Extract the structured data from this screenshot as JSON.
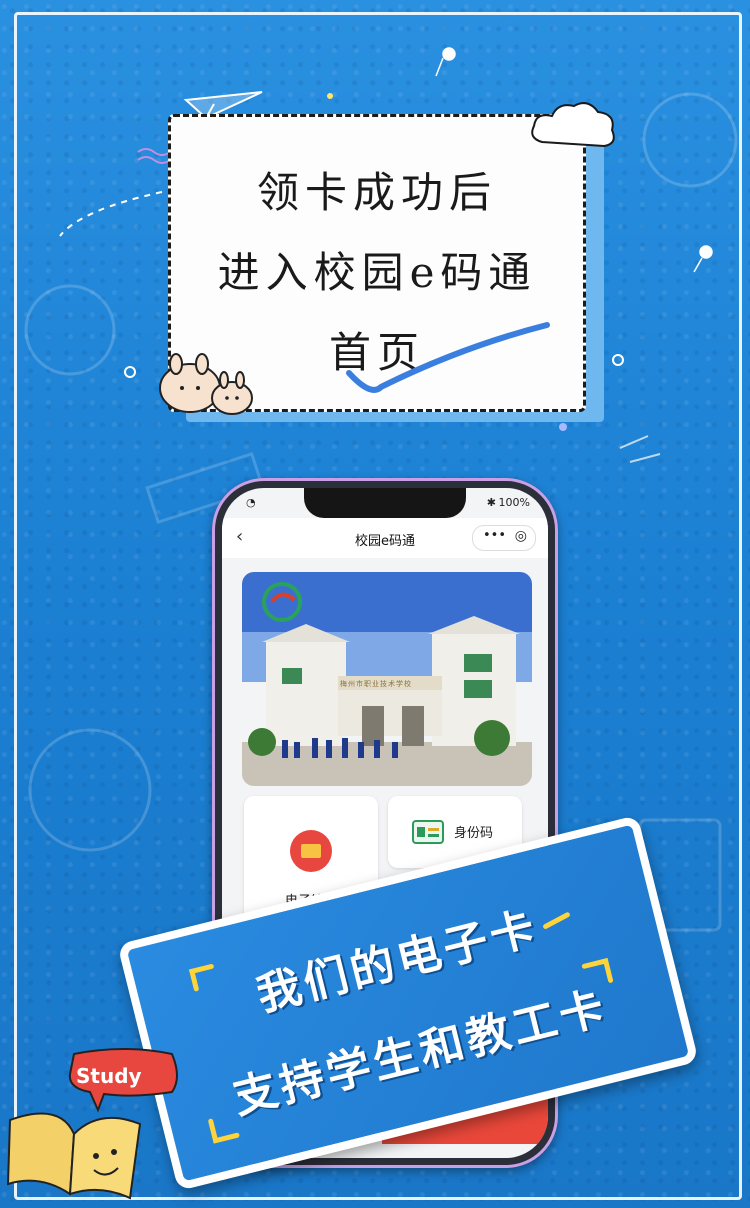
{
  "note": {
    "line1": "领卡成功后",
    "line2": "进入校园e码通",
    "line3": "首页"
  },
  "phone": {
    "status_battery": "100%",
    "nav_title": "校园e码通",
    "back_icon": "chevron-left-icon",
    "more_icon": "more-dots-icon",
    "close_icon": "target-close-icon",
    "banner_school_sign": "梅州市职业技术学校",
    "tiles": [
      {
        "label": "身份码",
        "icon": "id-card-icon"
      },
      {
        "label": "电子钱包",
        "sub": "¥",
        "icon": "wallet-icon"
      }
    ]
  },
  "sign": {
    "line1": "我们的电子卡",
    "line2": "支持学生和教工卡"
  },
  "doodle": {
    "study_label": "Study"
  },
  "colors": {
    "background": "#1f84d6",
    "sign_blue": "#2a8be0",
    "wallet_red": "#e8473f",
    "note_back": "#6fb7ef"
  }
}
